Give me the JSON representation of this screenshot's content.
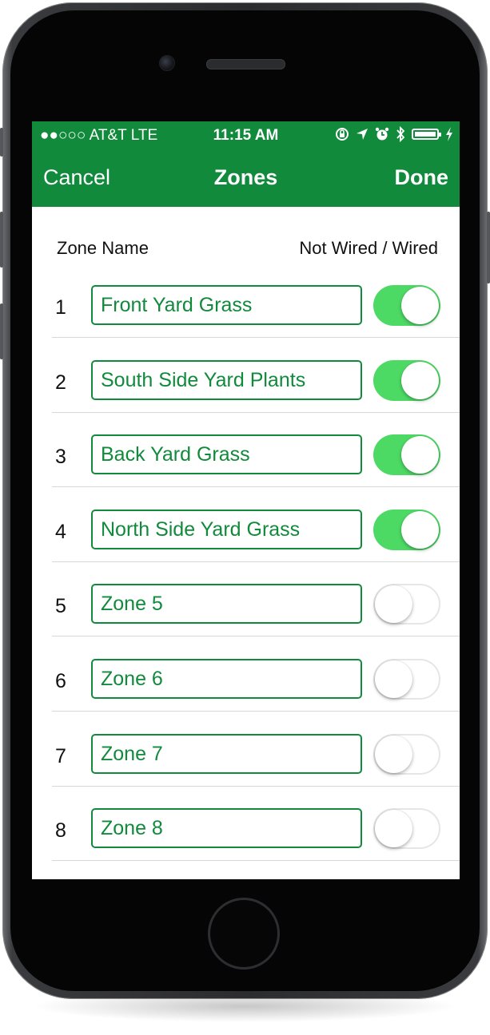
{
  "status_bar": {
    "carrier": "●●○○○ AT&T   LTE",
    "time": "11:15 AM",
    "icons": [
      "orientation-lock-icon",
      "location-arrow-icon",
      "alarm-icon",
      "bluetooth-icon",
      "battery-icon",
      "charging-icon"
    ]
  },
  "nav": {
    "cancel": "Cancel",
    "title": "Zones",
    "done": "Done"
  },
  "columns": {
    "left": "Zone Name",
    "right": "Not Wired / Wired"
  },
  "zones": [
    {
      "number": "1",
      "name": "Front Yard Grass",
      "wired": true
    },
    {
      "number": "2",
      "name": "South Side Yard Plants",
      "wired": true
    },
    {
      "number": "3",
      "name": "Back Yard Grass",
      "wired": true
    },
    {
      "number": "4",
      "name": "North Side Yard Grass",
      "wired": true
    },
    {
      "number": "5",
      "name": "Zone 5",
      "wired": false
    },
    {
      "number": "6",
      "name": "Zone 6",
      "wired": false
    },
    {
      "number": "7",
      "name": "Zone 7",
      "wired": false
    },
    {
      "number": "8",
      "name": "Zone 8",
      "wired": false
    }
  ],
  "colors": {
    "brand_green": "#118a3c",
    "toggle_on": "#4cd964"
  }
}
